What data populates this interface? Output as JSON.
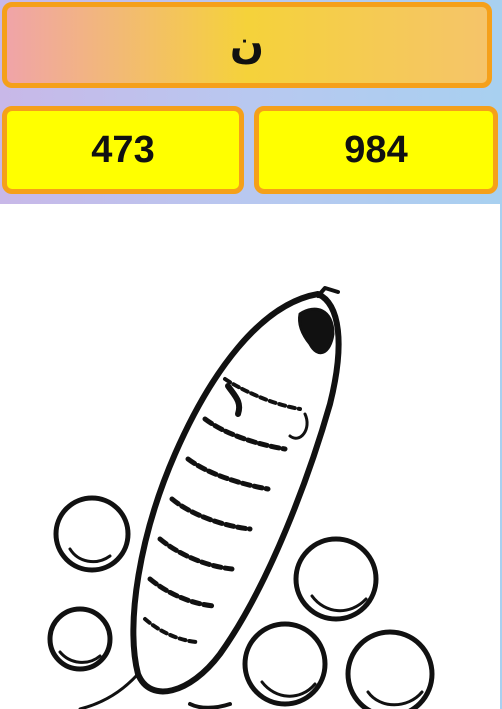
{
  "header": {
    "letter": "ن"
  },
  "options": [
    {
      "label": "473"
    },
    {
      "label": "984"
    }
  ],
  "illustration": {
    "icon": "larva-with-eggs-drawing"
  },
  "colors": {
    "tile_border": "#f5a01a",
    "tile_fill": "#ffff00",
    "header_gradient_start": "#f0a4a8",
    "header_gradient_mid": "#f5d23a"
  }
}
